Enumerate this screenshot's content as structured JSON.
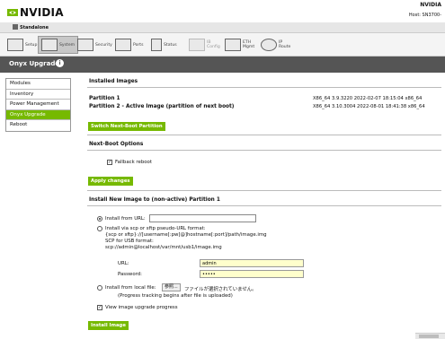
{
  "header": {
    "brand": "NVIDIA",
    "right_title": "NVIDIA",
    "host_label": "Host: SN3700-",
    "mode": "Standalone"
  },
  "tabs": [
    {
      "label": "Setup",
      "icon": "setup-icon"
    },
    {
      "label": "System",
      "icon": "system-icon"
    },
    {
      "label": "Security",
      "icon": "security-icon"
    },
    {
      "label": "Ports",
      "icon": "ports-icon"
    },
    {
      "label": "Status",
      "icon": "status-icon"
    },
    {
      "label": "IB\nConfig",
      "icon": "ib-config-icon"
    },
    {
      "label": "ETH\nMgmt",
      "icon": "eth-mgmt-icon"
    },
    {
      "label": "IP\nRoute",
      "icon": "ip-route-icon"
    }
  ],
  "page": {
    "title": "Onyx Upgrade"
  },
  "sidebar": {
    "items": [
      "Modules",
      "Inventory",
      "Power Management",
      "Onyx Upgrade",
      "Reboot"
    ],
    "active_index": 3
  },
  "installed": {
    "heading": "Installed Images",
    "partition1_label": "Partition 1",
    "partition1_value": "X86_64 3.9.3220 2022-02-07 18:15:04 x86_64",
    "partition2_label": "Partition 2 - Active Image (partition of next boot)",
    "partition2_value": "X86_64 3.10.3004 2022-08-01 18:41:38 x86_64",
    "switch_button": "Switch Next-Boot Partition"
  },
  "next_boot": {
    "heading": "Next-Boot Options",
    "fallback_label": "Fallback reboot",
    "fallback_checked": true,
    "apply_button": "Apply changes"
  },
  "install": {
    "heading": "Install New Image to (non-active) Partition 1",
    "from_url_label": "Install from URL:",
    "from_url_value": "",
    "scp_label": "Install via scp or sftp pseudo-URL format:",
    "scp_format": "{scp or sftp}://[username[:pw]@]hostname[:port]/path/image.img",
    "usb_label": "SCP for USB format:",
    "usb_format": "scp://admin@localhost/var/mnt/usb1/image.img",
    "url_label": "URL:",
    "url_value": "admin",
    "password_label": "Password:",
    "password_value": "•••••",
    "local_file_label": "Install from local file:",
    "file_button": "参照...",
    "file_status": "ファイルが選択されていません。",
    "progress_note": "(Progress tracking begins after file is uploaded)",
    "view_progress_label": "View image upgrade progress",
    "view_progress_checked": true,
    "install_button": "Install Image"
  },
  "colors": {
    "accent": "#76b900",
    "titlebar": "#555555",
    "field_yellow": "#ffffcc"
  }
}
